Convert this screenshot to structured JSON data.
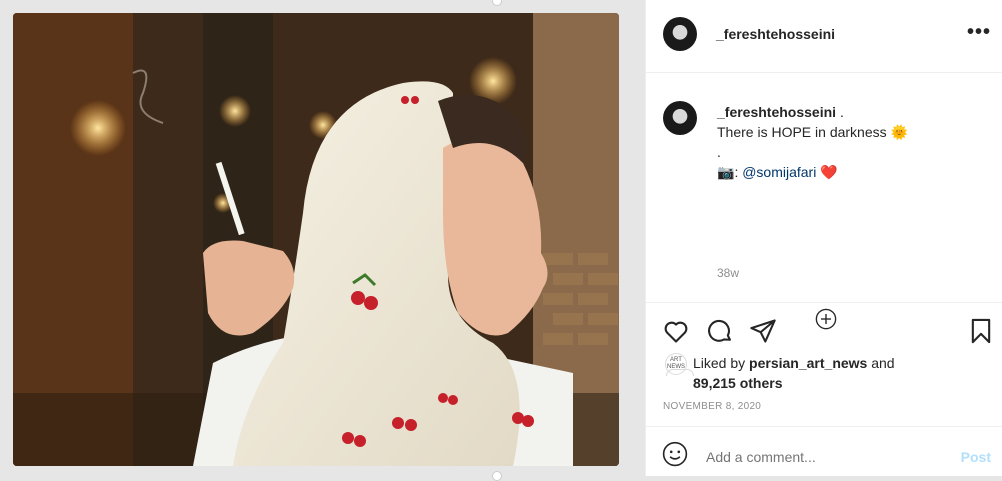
{
  "post": {
    "username": "_fereshtehosseini",
    "more_label": "•••",
    "caption": {
      "username": "_fereshtehosseini",
      "dot_after_name": ".",
      "line1": "There is HOPE in darkness",
      "line1_emoji": "🌞",
      "line2": ".",
      "camera_emoji": "📷",
      "credit_sep": ": ",
      "credit_handle": "@somijafari",
      "heart_emoji": "❤️"
    },
    "age": "38w",
    "likes": {
      "avatar_text": "ART NEWS",
      "prefix": "Liked by ",
      "liker": "persian_art_news",
      "and_text": " and",
      "count": "89,215 others"
    },
    "date": "NOVEMBER 8, 2020"
  },
  "comment": {
    "placeholder": "Add a comment...",
    "post_label": "Post"
  },
  "icons": {
    "like": "heart-outline",
    "comment": "speech-bubble",
    "share": "paper-plane",
    "save": "bookmark",
    "emoji": "smiley-face",
    "load_more": "plus-circle"
  }
}
